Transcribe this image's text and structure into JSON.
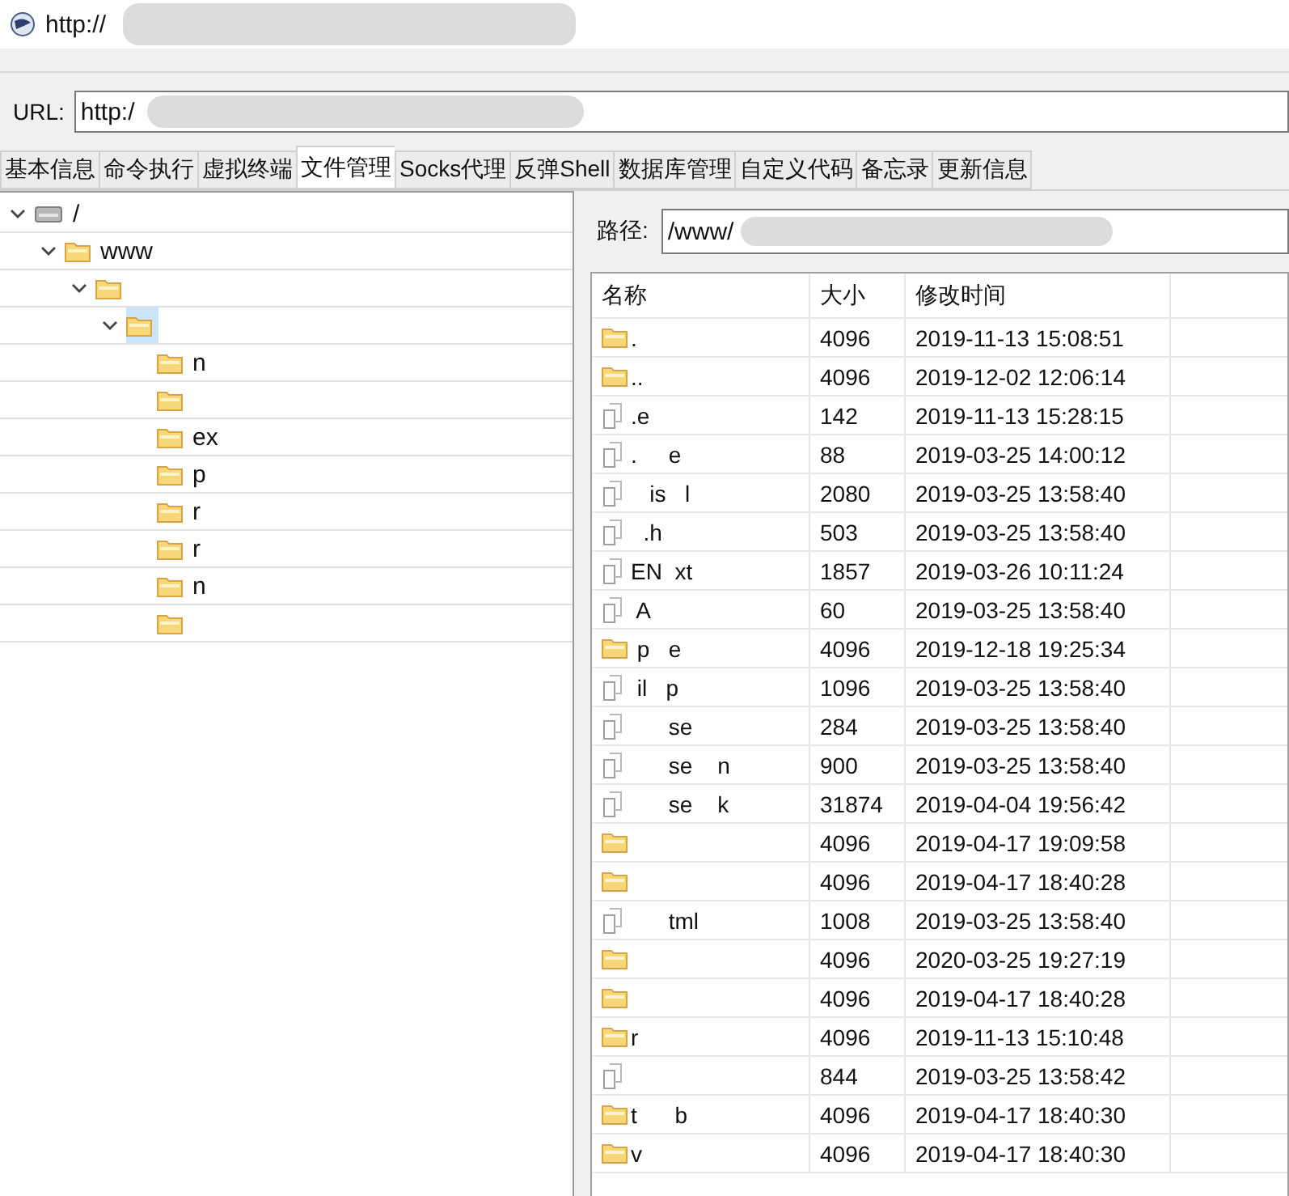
{
  "window": {
    "title": "http://"
  },
  "url": {
    "label": "URL:",
    "value": "http:/"
  },
  "tabs": [
    {
      "label": "基本信息",
      "selected": false
    },
    {
      "label": "命令执行",
      "selected": false
    },
    {
      "label": "虚拟终端",
      "selected": false
    },
    {
      "label": "文件管理",
      "selected": true
    },
    {
      "label": "Socks代理",
      "selected": false
    },
    {
      "label": "反弹Shell",
      "selected": false
    },
    {
      "label": "数据库管理",
      "selected": false
    },
    {
      "label": "自定义代码",
      "selected": false
    },
    {
      "label": "备忘录",
      "selected": false
    },
    {
      "label": "更新信息",
      "selected": false
    }
  ],
  "tree": [
    {
      "kind": "drive",
      "name": "/",
      "expanded": true,
      "selected": false,
      "children": [
        {
          "kind": "folder",
          "name": "www",
          "expanded": true,
          "selected": false,
          "children": [
            {
              "kind": "folder",
              "expanded": true,
              "selected": false,
              "children": [
                {
                  "kind": "folder",
                  "expanded": true,
                  "selected": true,
                  "children": [
                    {
                      "kind": "folder",
                      "name": "n",
                      "selected": false
                    },
                    {
                      "kind": "folder",
                      "selected": false
                    },
                    {
                      "kind": "folder",
                      "name": "ex",
                      "selected": false
                    },
                    {
                      "kind": "folder",
                      "name": "p",
                      "selected": false
                    },
                    {
                      "kind": "folder",
                      "name": "r",
                      "selected": false
                    },
                    {
                      "kind": "folder",
                      "name": "r",
                      "selected": false
                    },
                    {
                      "kind": "folder",
                      "name": "n",
                      "selected": false
                    },
                    {
                      "kind": "folder",
                      "selected": false
                    }
                  ]
                }
              ]
            }
          ]
        }
      ]
    }
  ],
  "path": {
    "label": "路径:",
    "value": "/www/"
  },
  "table": {
    "columns": [
      "名称",
      "大小",
      "修改时间"
    ],
    "rows": [
      {
        "kind": "folder",
        "name": ".",
        "size": "4096",
        "modified": "2019-11-13 15:08:51"
      },
      {
        "kind": "folder",
        "name": "..",
        "size": "4096",
        "modified": "2019-12-02 12:06:14"
      },
      {
        "kind": "file",
        "name": ".e",
        "size": "142",
        "modified": "2019-11-13 15:28:15"
      },
      {
        "kind": "file",
        "name": ".     e",
        "size": "88",
        "modified": "2019-03-25 14:00:12"
      },
      {
        "kind": "file",
        "name": "   is   l",
        "size": "2080",
        "modified": "2019-03-25 13:58:40"
      },
      {
        "kind": "file",
        "name": "  .h",
        "size": "503",
        "modified": "2019-03-25 13:58:40"
      },
      {
        "kind": "file",
        "name": "EN  xt",
        "size": "1857",
        "modified": "2019-03-26 10:11:24"
      },
      {
        "kind": "file",
        "name": " A",
        "size": "60",
        "modified": "2019-03-25 13:58:40"
      },
      {
        "kind": "folder",
        "name": " p   e",
        "size": "4096",
        "modified": "2019-12-18 19:25:34"
      },
      {
        "kind": "file",
        "name": " il   p",
        "size": "1096",
        "modified": "2019-03-25 13:58:40"
      },
      {
        "kind": "file",
        "name": "      se",
        "size": "284",
        "modified": "2019-03-25 13:58:40"
      },
      {
        "kind": "file",
        "name": "      se    n",
        "size": "900",
        "modified": "2019-03-25 13:58:40"
      },
      {
        "kind": "file",
        "name": "      se    k",
        "size": "31874",
        "modified": "2019-04-04 19:56:42"
      },
      {
        "kind": "folder",
        "size": "4096",
        "modified": "2019-04-17 19:09:58"
      },
      {
        "kind": "folder",
        "size": "4096",
        "modified": "2019-04-17 18:40:28"
      },
      {
        "kind": "file",
        "name": "      tml",
        "size": "1008",
        "modified": "2019-03-25 13:58:40"
      },
      {
        "kind": "folder",
        "size": "4096",
        "modified": "2020-03-25 19:27:19"
      },
      {
        "kind": "folder",
        "size": "4096",
        "modified": "2019-04-17 18:40:28"
      },
      {
        "kind": "folder",
        "name": "r",
        "size": "4096",
        "modified": "2019-11-13 15:10:48"
      },
      {
        "kind": "file",
        "size": "844",
        "modified": "2019-03-25 13:58:42"
      },
      {
        "kind": "folder",
        "name": "t      b",
        "size": "4096",
        "modified": "2019-04-17 18:40:30"
      },
      {
        "kind": "folder",
        "name": "v",
        "size": "4096",
        "modified": "2019-04-17 18:40:30"
      }
    ]
  }
}
